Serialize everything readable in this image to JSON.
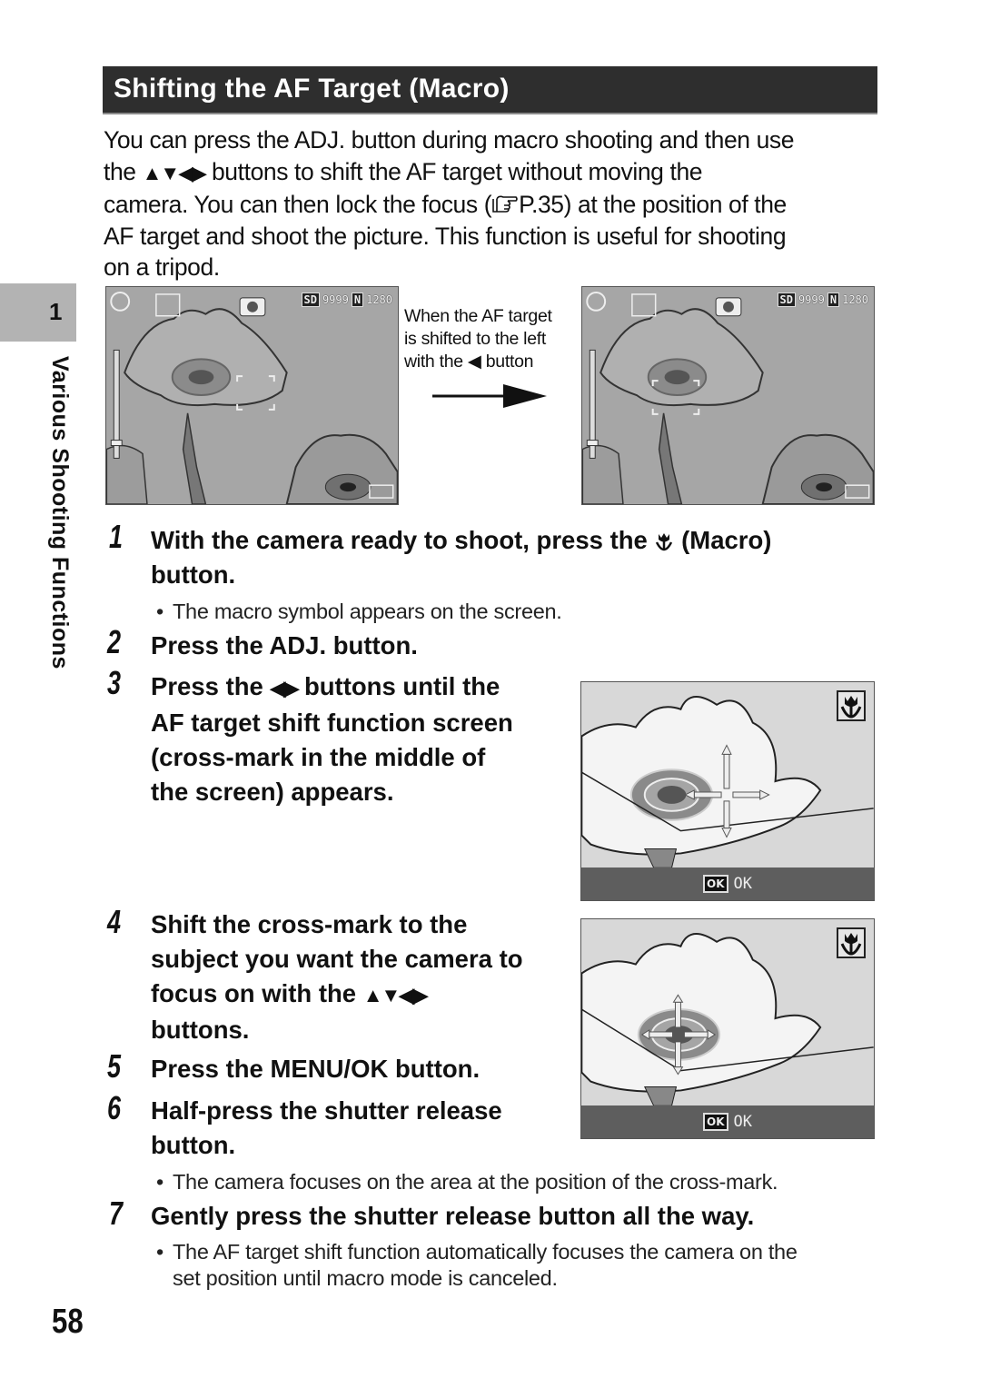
{
  "section": {
    "title": "Shifting the AF Target (Macro)",
    "header_bg": "#2e2e2e"
  },
  "intro": {
    "line1": "You can press the ADJ. button during macro shooting and then use",
    "line2_pre": "the ",
    "line2_arrows": "▲▼◀▶",
    "line2_post": " buttons to shift the AF target without moving the",
    "line3_pre": "camera. You can then lock the focus (",
    "line3_ref_icon": "pointing-hand-icon",
    "line3_ref": "P.35",
    "line3_post": ") at the position of the",
    "line4": "AF target and shoot the picture. This function is useful for shooting",
    "line5": "on a tripod."
  },
  "chapter": {
    "number": "1",
    "title": "Various Shooting Functions",
    "tab_color": "#b3b3b3"
  },
  "screens": {
    "status": {
      "media": "SD",
      "remaining": "9999",
      "quality": "N",
      "size": "1280"
    },
    "caption_line1": "When the AF target",
    "caption_line2": "is shifted to the left",
    "caption_line3_pre": "with the ",
    "caption_line3_icon": "◀",
    "caption_line3_post": " button",
    "ok_icon": "OK",
    "ok_label": "OK"
  },
  "steps": [
    {
      "number": "1",
      "line1_pre": "With the camera ready to shoot, press the ",
      "line1_icon": "macro-icon",
      "line1_post": " (Macro)",
      "line2": "button.",
      "bullet": "The macro symbol appears on the screen."
    },
    {
      "number": "2",
      "line1": "Press the ADJ. button."
    },
    {
      "number": "3",
      "line1_pre": "Press the ",
      "line1_arrows": "◀▶",
      "line1_post": " buttons until the",
      "line2": "AF target shift function screen",
      "line3": "(cross-mark in the middle of",
      "line4": "the screen) appears."
    },
    {
      "number": "4",
      "line1": "Shift the cross-mark to the",
      "line2": "subject you want the camera to",
      "line3_pre": "focus on with the ",
      "line3_arrows": "▲▼◀▶",
      "line4": "buttons."
    },
    {
      "number": "5",
      "line1": "Press the MENU/OK button."
    },
    {
      "number": "6",
      "line1": "Half-press the shutter release",
      "line2": "button.",
      "bullet": "The camera focuses on the area at the position of the cross-mark."
    },
    {
      "number": "7",
      "line1": "Gently press the shutter release button all the way.",
      "bullet_line1": "The AF target shift function automatically focuses the camera on the",
      "bullet_line2": "set position until macro mode is canceled."
    }
  ],
  "footer": {
    "page_number": "58"
  }
}
